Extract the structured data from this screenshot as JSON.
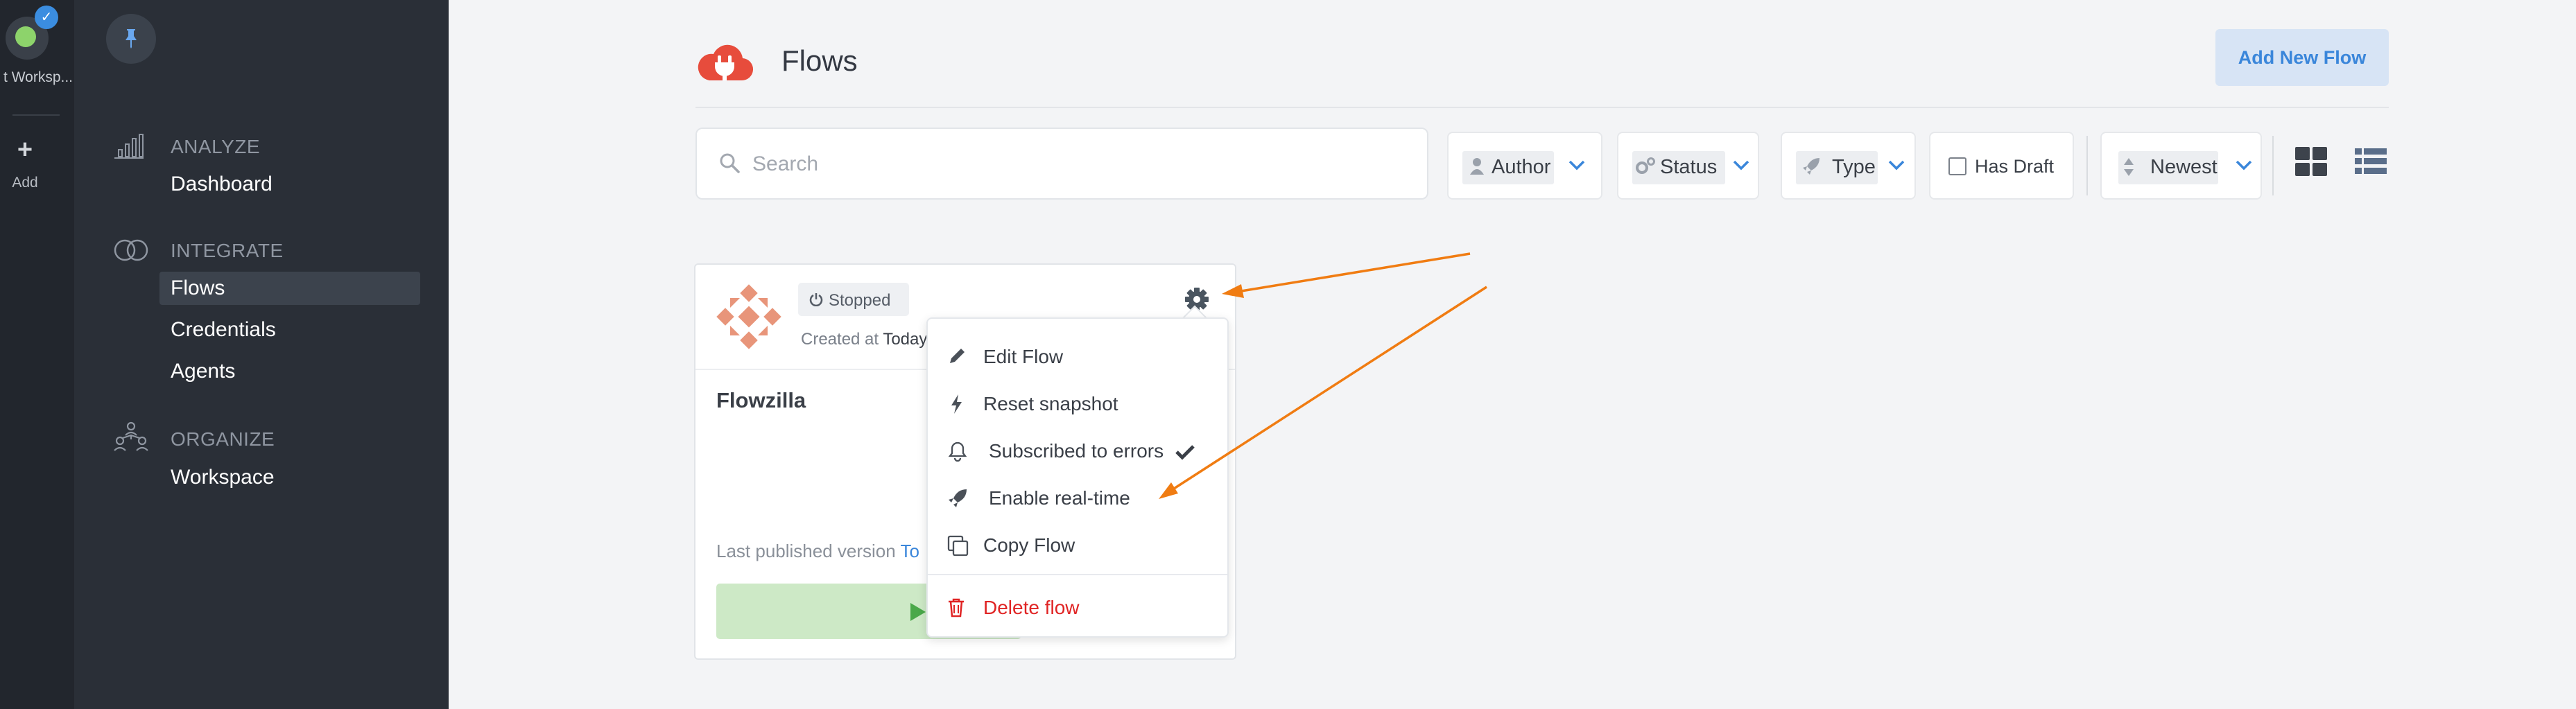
{
  "workspace": {
    "name": "t Worksp..."
  },
  "rail": {
    "add_label": "Add"
  },
  "sidebar": {
    "sections": [
      {
        "title": "ANALYZE",
        "items": [
          "Dashboard"
        ]
      },
      {
        "title": "INTEGRATE",
        "items": [
          "Flows",
          "Credentials",
          "Agents"
        ]
      },
      {
        "title": "ORGANIZE",
        "items": [
          "Workspace"
        ]
      }
    ],
    "active_item": "Flows"
  },
  "header": {
    "title": "Flows",
    "add_button": "Add New Flow"
  },
  "search": {
    "placeholder": "Search",
    "value": ""
  },
  "filters": {
    "author": "Author",
    "status": "Status",
    "type": "Type",
    "has_draft": "Has Draft",
    "has_draft_checked": false,
    "sort": "Newest"
  },
  "flow_card": {
    "status": "Stopped",
    "created_prefix": "Created at",
    "created_value": "Today",
    "title": "Flowzilla",
    "published_prefix": "Last published version",
    "published_value": "To"
  },
  "context_menu": {
    "items": [
      {
        "label": "Edit Flow",
        "icon": "pencil-icon"
      },
      {
        "label": "Reset snapshot",
        "icon": "bolt-icon"
      },
      {
        "label": "Subscribed to errors",
        "icon": "bell-icon",
        "checked": true
      },
      {
        "label": "Enable real-time",
        "icon": "rocket-icon"
      },
      {
        "label": "Copy Flow",
        "icon": "copy-icon"
      }
    ],
    "delete": {
      "label": "Delete flow",
      "icon": "trash-icon"
    }
  },
  "colors": {
    "accent": "#3a86da",
    "danger": "#e02424",
    "annotation_arrow": "#f07c12",
    "sidebar_bg": "#2a2f37",
    "logo": "#e74c3c"
  }
}
